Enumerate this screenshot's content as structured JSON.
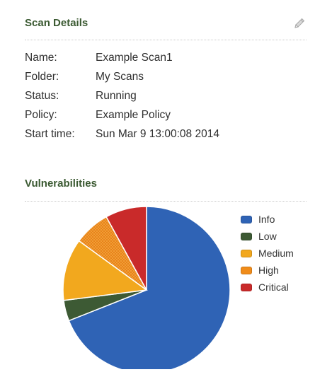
{
  "scan_details": {
    "title": "Scan Details",
    "fields": [
      {
        "label": "Name:",
        "value": "Example Scan1"
      },
      {
        "label": "Folder:",
        "value": "My Scans"
      },
      {
        "label": "Status:",
        "value": "Running"
      },
      {
        "label": "Policy:",
        "value": "Example Policy"
      },
      {
        "label": "Start time:",
        "value": "Sun Mar 9 13:00:08 2014"
      }
    ]
  },
  "vulnerabilities": {
    "title": "Vulnerabilities"
  },
  "chart_data": {
    "type": "pie",
    "slices": [
      {
        "name": "Info",
        "value": 69,
        "color": "#2f63b5"
      },
      {
        "name": "Low",
        "value": 4,
        "color": "#3d5a34"
      },
      {
        "name": "Medium",
        "value": 12,
        "color": "#f2a81e"
      },
      {
        "name": "High",
        "value": 7,
        "color": "#f08c1a"
      },
      {
        "name": "Critical",
        "value": 8,
        "color": "#c92a2a"
      }
    ],
    "legend_position": "right"
  }
}
